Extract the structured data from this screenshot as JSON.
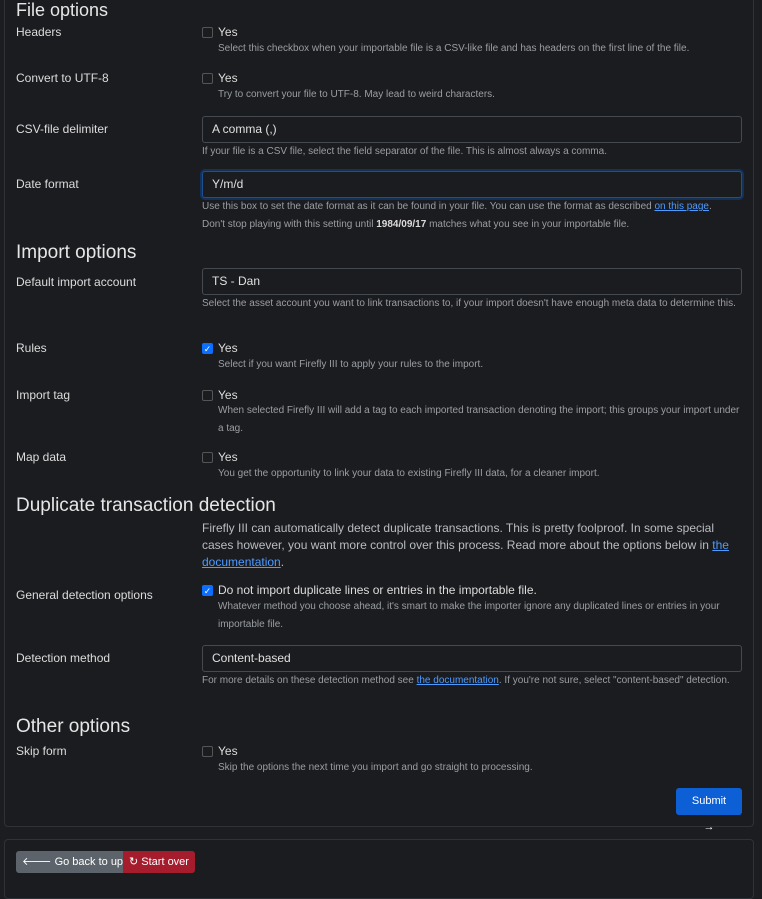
{
  "file_options": {
    "title": "File options",
    "headers": {
      "label": "Headers",
      "checkbox": "Yes",
      "checked": false,
      "help": "Select this checkbox when your importable file is a CSV-like file and has headers on the first line of the file."
    },
    "utf8": {
      "label": "Convert to UTF-8",
      "checkbox": "Yes",
      "checked": false,
      "help": "Try to convert your file to UTF-8. May lead to weird characters."
    },
    "delimiter": {
      "label": "CSV-file delimiter",
      "value": "A comma (,)",
      "help": "If your file is a CSV file, select the field separator of the file. This is almost always a comma."
    },
    "date_format": {
      "label": "Date format",
      "value": "Y/m/d",
      "help1": "Use this box to set the date format as it can be found in your file. You can use the format as described ",
      "help_link": "on this page",
      "help1_end": ".",
      "help2a": "Don't stop playing with this setting until ",
      "help2_date": "1984/09/17",
      "help2b": " matches what you see in your importable file."
    }
  },
  "import_options": {
    "title": "Import options",
    "account": {
      "label": "Default import account",
      "value": "TS - Dan",
      "help": "Select the asset account you want to link transactions to, if your import doesn't have enough meta data to determine this."
    },
    "rules": {
      "label": "Rules",
      "checkbox": "Yes",
      "checked": true,
      "help": "Select if you want Firefly III to apply your rules to the import."
    },
    "tag": {
      "label": "Import tag",
      "checkbox": "Yes",
      "checked": false,
      "help": "When selected Firefly III will add a tag to each imported transaction denoting the import; this groups your import under a tag."
    },
    "map": {
      "label": "Map data",
      "checkbox": "Yes",
      "checked": false,
      "help": "You get the opportunity to link your data to existing Firefly III data, for a cleaner import."
    }
  },
  "duplicate": {
    "title": "Duplicate transaction detection",
    "intro": "Firefly III can automatically detect duplicate transactions. This is pretty foolproof. In some special cases however, you want more control over this process. Read more about the options below in ",
    "intro_link": "the documentation",
    "intro_end": ".",
    "general": {
      "label": "General detection options",
      "checkbox": "Do not import duplicate lines or entries in the importable file.",
      "checked": true,
      "help": "Whatever method you choose ahead, it's smart to make the importer ignore any duplicated lines or entries in your importable file."
    },
    "method": {
      "label": "Detection method",
      "value": "Content-based",
      "help_a": "For more details on these detection method see ",
      "help_link": "the documentation",
      "help_b": ". If you're not sure, select \"content-based\" detection."
    }
  },
  "other": {
    "title": "Other options",
    "skip": {
      "label": "Skip form",
      "checkbox": "Yes",
      "checked": false,
      "help": "Skip the options the next time you import and go straight to processing."
    }
  },
  "buttons": {
    "submit": "Submit →",
    "back": "Go back to upload",
    "start_over": "Start over"
  },
  "colors": {
    "primary": "#0d6efd",
    "danger": "#a51d2d",
    "secondary": "#5c636a"
  }
}
